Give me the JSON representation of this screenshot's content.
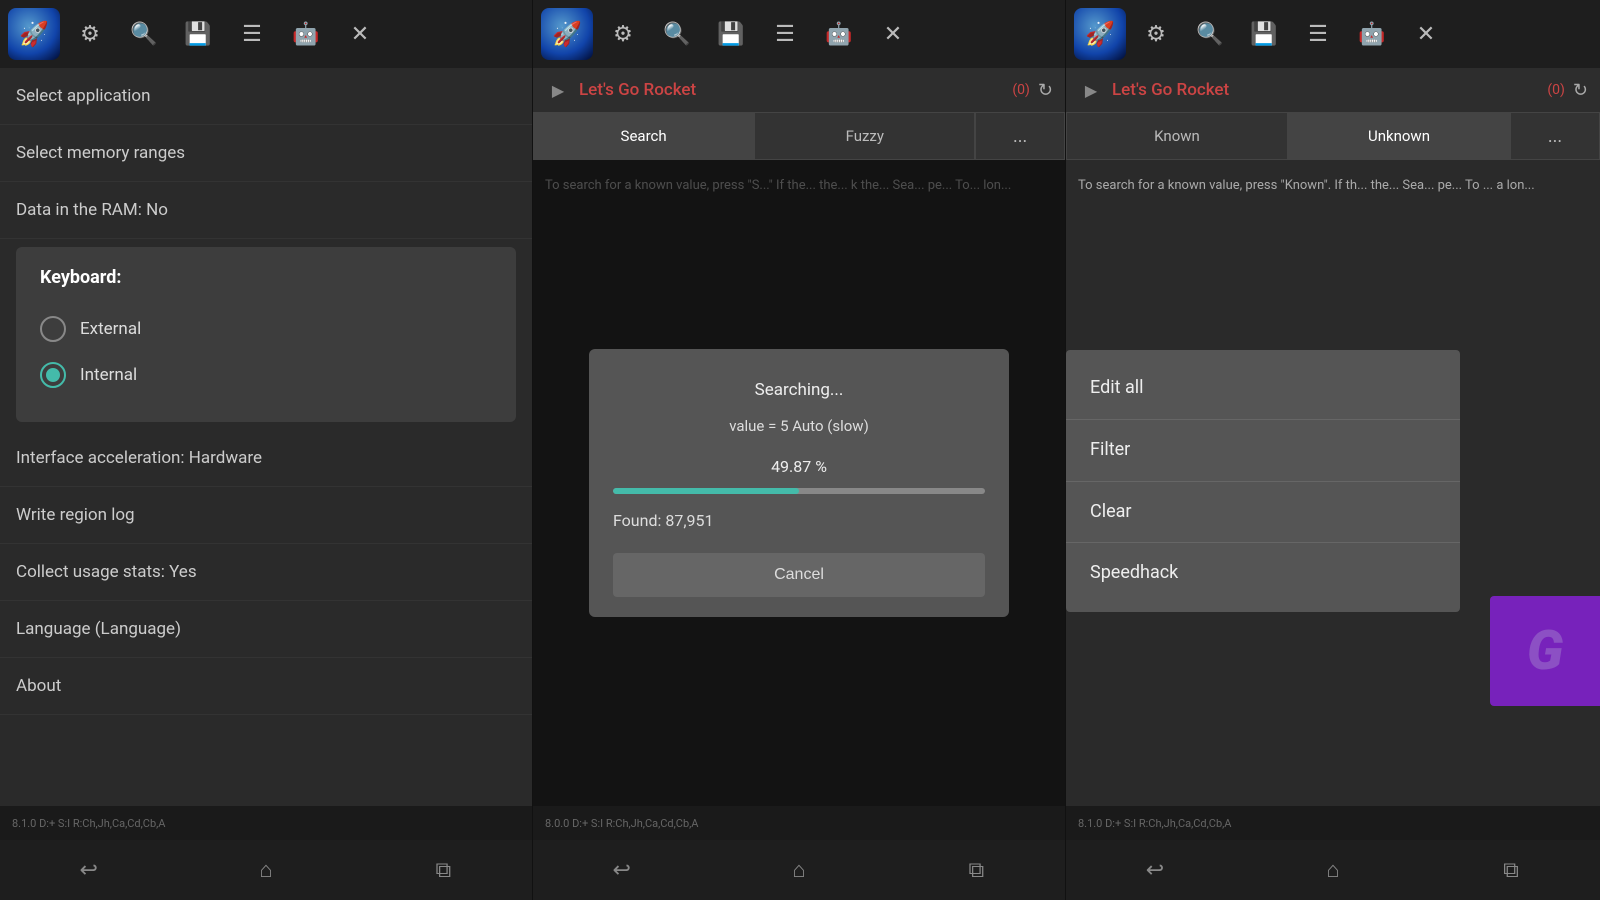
{
  "panel1": {
    "toolbar": {
      "icons": [
        "🚀",
        "⚙",
        "🔍",
        "💾",
        "☰",
        "🤖",
        "✕"
      ]
    },
    "settings_items": [
      "Select application",
      "Select memory ranges",
      "Data in the RAM: No"
    ],
    "hidden_item": "",
    "keyboard_dialog": {
      "title": "Keyboard:",
      "options": [
        {
          "label": "External",
          "selected": false
        },
        {
          "label": "Internal",
          "selected": true
        }
      ]
    },
    "settings_items_below": [
      "Interface acceleration: Hardware",
      "Write region log",
      "Collect usage stats: Yes",
      "Language (Language)",
      "About"
    ],
    "status": "8.1.0   D:+   S:I   R:Ch,Jh,Ca,Cd,Cb,A",
    "nav": [
      "↩",
      "⌂",
      "⧉"
    ]
  },
  "panel2": {
    "toolbar": {
      "icons": [
        "🚀",
        "⚙",
        "🔍",
        "💾",
        "☰",
        "🤖",
        "✕"
      ]
    },
    "app_title": "Let's Go Rocket",
    "counter": "(0)",
    "tabs": [
      "Search",
      "Fuzzy",
      "..."
    ],
    "desc_text": "To search for a known value, press \"S...\" If th... the... k the... Sea... pe... To... lon...",
    "dialog": {
      "searching_label": "Searching...",
      "value_label": "value = 5 Auto (slow)",
      "percent": "49.87 %",
      "progress": 49.87,
      "found_label": "Found: 87,951",
      "cancel_label": "Cancel"
    },
    "status": "8.0.0   D:+   S:I   R:Ch,Jh,Ca,Cd,Cb,A",
    "nav": [
      "↩",
      "⌂",
      "⧉"
    ]
  },
  "panel3": {
    "toolbar": {
      "icons": [
        "🚀",
        "⚙",
        "🔍",
        "💾",
        "☰",
        "🤖",
        "✕"
      ]
    },
    "app_title": "Let's Go Rocket",
    "counter": "(0)",
    "tabs": [
      "Known",
      "Unknown",
      "..."
    ],
    "active_tab": "Unknown",
    "desc_text": "To search for a known value, press \"Known\". If th... the... Sea... pe... To ... a lon...",
    "context_menu": {
      "items": [
        "Edit all",
        "Filter",
        "Clear",
        "Speedhack"
      ]
    },
    "gg_logo_text": "G",
    "status": "8.1.0   D:+   S:I   R:Ch,Jh,Ca,Cd,Cb,A",
    "nav": [
      "↩",
      "⌂",
      "⧉"
    ]
  }
}
